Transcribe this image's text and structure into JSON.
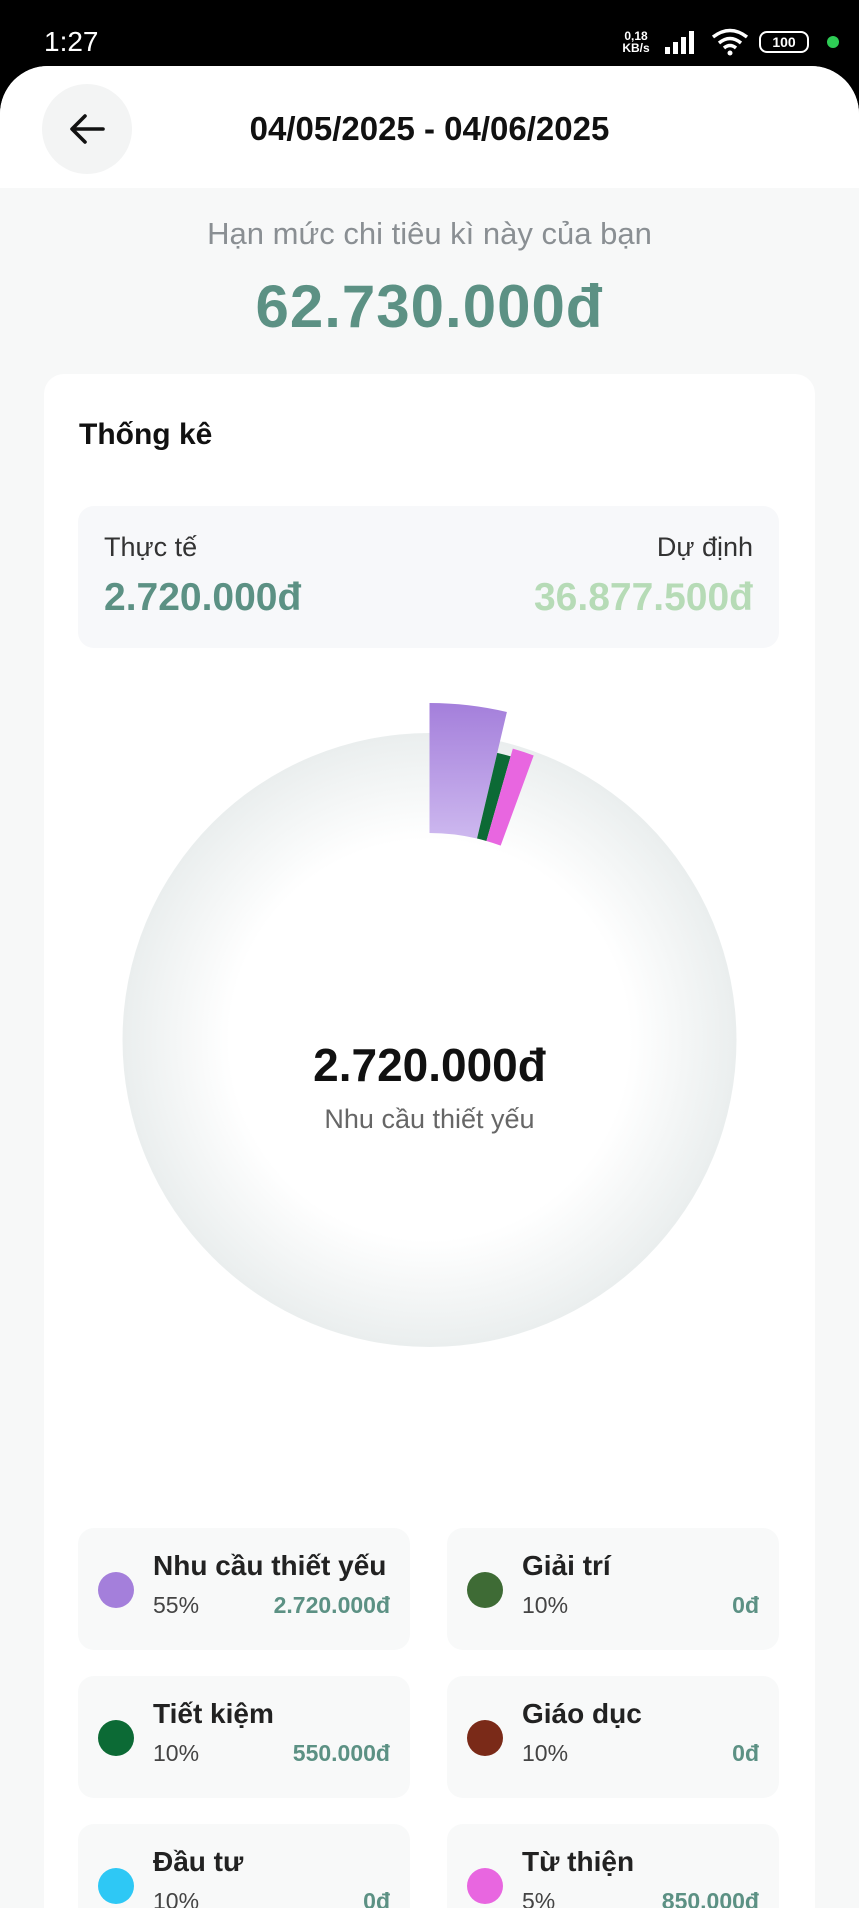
{
  "status_bar": {
    "time": "1:27",
    "net_speed_value": "0,18",
    "net_speed_unit": "KB/s",
    "battery": "100"
  },
  "header": {
    "back_icon": "arrow-left-icon",
    "date_range": "04/05/2025 - 04/06/2025"
  },
  "limit": {
    "label": "Hạn mức chi tiêu kì này của bạn",
    "value": "62.730.000đ"
  },
  "stats": {
    "title": "Thống kê",
    "actual_label": "Thực tế",
    "actual_value": "2.720.000đ",
    "planned_label": "Dự định",
    "planned_value": "36.877.500đ",
    "center_amount": "2.720.000đ",
    "center_label": "Nhu cầu thiết yếu"
  },
  "categories": [
    {
      "name": "Nhu cầu thiết yếu",
      "percent": "55%",
      "amount": "2.720.000đ",
      "color": "#a47fdb"
    },
    {
      "name": "Giải trí",
      "percent": "10%",
      "amount": "0đ",
      "color": "#3e6b35"
    },
    {
      "name": "Tiết kiệm",
      "percent": "10%",
      "amount": "550.000đ",
      "color": "#0c6a35"
    },
    {
      "name": "Giáo dục",
      "percent": "10%",
      "amount": "0đ",
      "color": "#7a2a18"
    },
    {
      "name": "Đầu tư",
      "percent": "10%",
      "amount": "0đ",
      "color": "#2ec8f5"
    },
    {
      "name": "Từ thiện",
      "percent": "5%",
      "amount": "850.000đ",
      "color": "#e866e0"
    }
  ],
  "chart_data": {
    "type": "pie",
    "variant": "donut",
    "highlighted": "Nhu cầu thiết yếu",
    "track_color": "#eef1f1",
    "segments": [
      {
        "name": "Nhu cầu thiết yếu",
        "value": 2720000,
        "color": "#a47fdb",
        "exploded": true
      },
      {
        "name": "Tiết kiệm",
        "value": 550000,
        "color": "#0c6a35"
      },
      {
        "name": "Từ thiện",
        "value": 850000,
        "color": "#e866e0"
      }
    ]
  }
}
